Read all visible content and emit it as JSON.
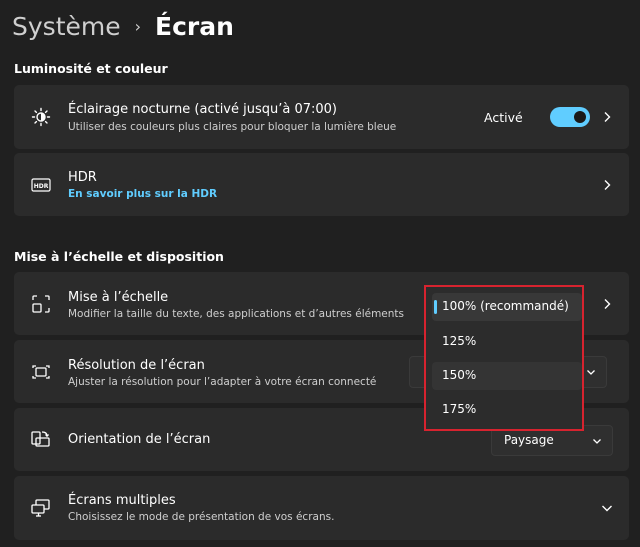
{
  "breadcrumb": {
    "parent": "Système",
    "separator": "›",
    "current": "Écran"
  },
  "sections": {
    "brightness": "Luminosité et couleur",
    "scale": "Mise à l’échelle et disposition"
  },
  "night_light": {
    "title": "Éclairage nocturne (activé jusqu’à 07:00)",
    "subtitle": "Utiliser des couleurs plus claires pour bloquer la lumière bleue",
    "state_label": "Activé",
    "enabled": true
  },
  "hdr": {
    "title": "HDR",
    "link": "En savoir plus sur la HDR"
  },
  "scale": {
    "title": "Mise à l’échelle",
    "subtitle": "Modifier la taille du texte, des applications et d’autres éléments",
    "options": [
      "100% (recommandé)",
      "125%",
      "150%",
      "175%"
    ],
    "selected": "100% (recommandé)"
  },
  "resolution": {
    "title": "Résolution de l’écran",
    "subtitle": "Ajuster la résolution pour l’adapter à  votre  écran connecté"
  },
  "orientation": {
    "title": "Orientation de l’écran",
    "value": "Paysage"
  },
  "multiple": {
    "title": "Écrans multiples",
    "subtitle": "Choisissez le mode de présentation de vos écrans."
  },
  "colors": {
    "accent": "#60cdff",
    "highlight_border": "#d7232f"
  }
}
